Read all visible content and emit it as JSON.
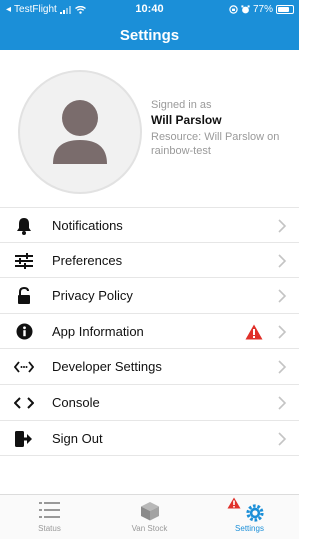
{
  "status_bar": {
    "carrier": "TestFlight",
    "time": "10:40",
    "battery": "77%",
    "battery_level": 0.77
  },
  "header": {
    "title": "Settings"
  },
  "profile": {
    "signed_in_label": "Signed in as",
    "name": "Will Parslow",
    "resource": "Resource: Will Parslow on rainbow-test"
  },
  "menu": [
    {
      "label": "Notifications",
      "icon": "bell-icon"
    },
    {
      "label": "Preferences",
      "icon": "sliders-icon"
    },
    {
      "label": "Privacy Policy",
      "icon": "lock-icon"
    },
    {
      "label": "App Information",
      "icon": "info-icon",
      "warning": true
    },
    {
      "label": "Developer Settings",
      "icon": "code-arrows-icon"
    },
    {
      "label": "Console",
      "icon": "console-icon"
    },
    {
      "label": "Sign Out",
      "icon": "sign-out-icon"
    }
  ],
  "tabs": [
    {
      "label": "Status",
      "icon": "list-icon",
      "active": false
    },
    {
      "label": "Van Stock",
      "icon": "box-icon",
      "active": false
    },
    {
      "label": "Settings",
      "icon": "gear-icon",
      "active": true,
      "warning": true
    }
  ],
  "colors": {
    "accent": "#1b8fd8",
    "warning": "#e0302a",
    "active_tab": "#1b8fd8",
    "inactive_tab": "#999999"
  }
}
